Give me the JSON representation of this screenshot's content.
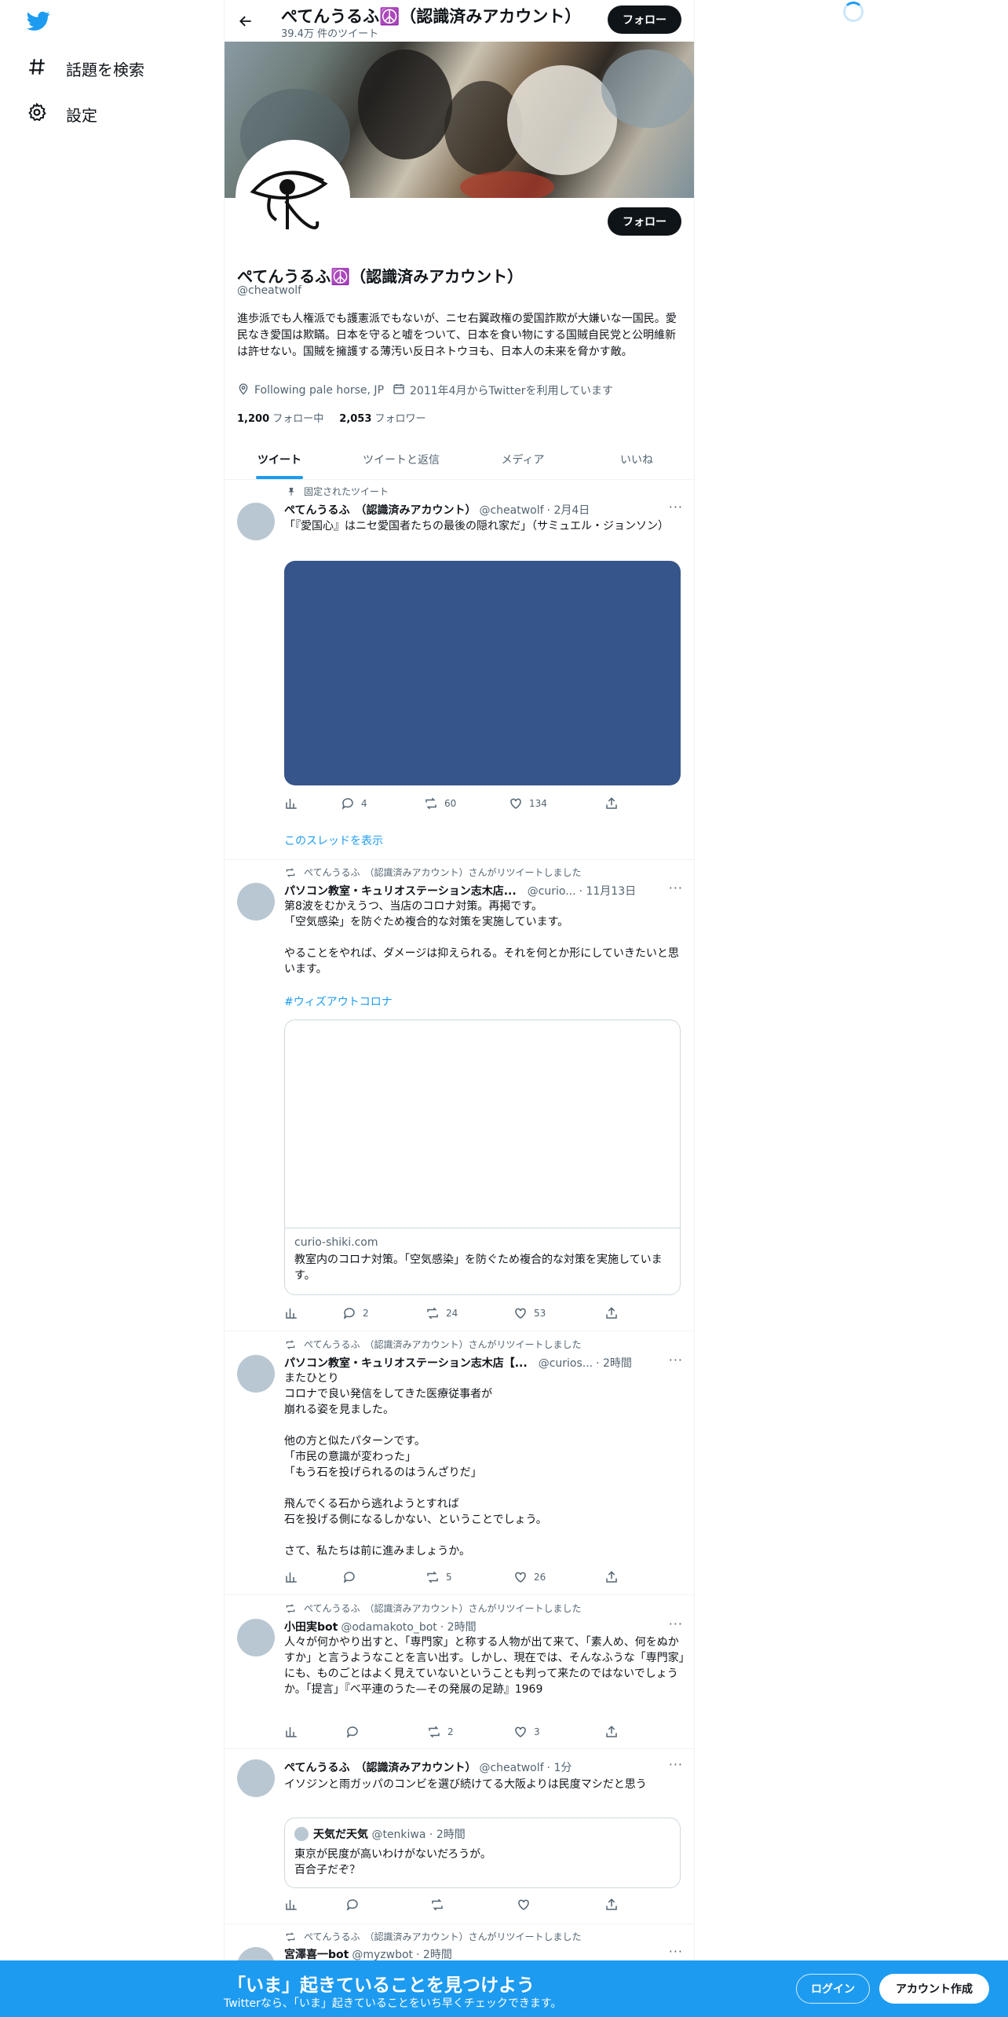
{
  "app": {
    "logo": "twitter-bird-icon",
    "accent": "#1d9bf0"
  },
  "nav": {
    "items": [
      {
        "icon": "hashtag-icon",
        "label": "話題を検索"
      },
      {
        "icon": "gear-icon",
        "label": "設定"
      }
    ]
  },
  "header": {
    "title": "ぺてんうるふ☮️（認識済みアカウント）",
    "tweet_count": "39.4万 件のツイート",
    "follow_label": "フォロー"
  },
  "profile": {
    "name": "ぺてんうるふ☮️（認識済みアカウント）",
    "handle": "@cheatwolf",
    "bio": "進歩派でも人権派でも護憲派でもないが、ニセ右翼政権の愛国詐欺が大嫌いな一国民。愛民なき愛国は欺瞞。日本を守ると嘘をついて、日本を食い物にする国賊自民党と公明維新は許せない。国賊を擁護する薄汚い反日ネトウヨも、日本人の未来を脅かす敵。",
    "location": "Following pale horse, JP",
    "joined": "2011年4月からTwitterを利用しています",
    "following_count": "1,200",
    "following_label": "フォロー中",
    "followers_count": "2,053",
    "followers_label": "フォロワー",
    "follow_label": "フォロー"
  },
  "tabs": [
    {
      "label": "ツイート",
      "active": true
    },
    {
      "label": "ツイートと返信",
      "active": false
    },
    {
      "label": "メディア",
      "active": false
    },
    {
      "label": "いいね",
      "active": false
    }
  ],
  "tweets": [
    {
      "context": "固定されたツイート",
      "name": "ぺてんうるふ　（認識済みアカウント）",
      "handle": "@cheatwolf",
      "time": "· 2月4日",
      "text": "「『愛国心』はニセ愛国者たちの最後の隠れ家だ」（サミュエル・ジョンソン）",
      "media_color": "#36558a",
      "replies": "4",
      "retweets": "60",
      "likes": "134",
      "thread_link": "このスレッドを表示"
    },
    {
      "context": "ぺてんうるふ　（認識済みアカウント）さんがリツイートしました",
      "name": "パソコン教室・キュリオステーション志木店...",
      "handle": "@curio...",
      "time": "· 11月13日",
      "text": "第8波をむかえうつ、当店のコロナ対策。再掲です。\n「空気感染」を防ぐため複合的な対策を実施しています。\n\nやることをやれば、ダメージは抑えられる。それを何とか形にしていきたいと思います。",
      "hashtag": "#ウィズアウトコロナ",
      "card_domain": "curio-shiki.com",
      "card_title": "教室内のコロナ対策。「空気感染」を防ぐため複合的な対策を実施しています。",
      "replies": "2",
      "retweets": "24",
      "likes": "53"
    },
    {
      "context": "ぺてんうるふ　（認識済みアカウント）さんがリツイートしました",
      "name": "パソコン教室・キュリオステーション志木店【...",
      "handle": "@curios...",
      "time": "· 2時間",
      "text": "またひとり\nコロナで良い発信をしてきた医療従事者が\n崩れる姿を見ました。\n\n他の方と似たパターンです。\n「市民の意識が変わった」\n「もう石を投げられるのはうんざりだ」\n\n飛んでくる石から逃れようとすれば\n石を投げる側になるしかない、ということでしょう。\n\nさて、私たちは前に進みましょうか。",
      "replies": "",
      "retweets": "5",
      "likes": "26"
    },
    {
      "context": "ぺてんうるふ　（認識済みアカウント）さんがリツイートしました",
      "name": "小田実bot",
      "handle": "@odamakoto_bot",
      "time": "· 2時間",
      "text": "人々が何かやり出すと、「専門家」と称する人物が出て来て、「素人め、何をぬかすか」と言うようなことを言い出す。しかし、現在では、そんなふうな「専門家」にも、ものごとはよく見えていないということも判って来たのではないでしょうか。「提言」『べ平連のうた—その発展の足跡』1969",
      "replies": "",
      "retweets": "2",
      "likes": "3"
    },
    {
      "name": "ぺてんうるふ　（認識済みアカウント）",
      "handle": "@cheatwolf",
      "time": "· 1分",
      "text": "イソジンと雨ガッパのコンビを選び続けてる大阪よりは民度マシだと思う",
      "quote_name": "天気だ天気",
      "quote_handle": "@tenkiwa",
      "quote_time": "· 2時間",
      "quote_text": "東京が民度が高いわけがないだろうが。\n百合子だぞ？",
      "replies": "",
      "retweets": "",
      "likes": ""
    },
    {
      "context": "ぺてんうるふ　（認識済みアカウント）さんがリツイートしました",
      "name": "宮澤喜一bot",
      "handle": "@myzwbot",
      "time": "· 2時間"
    }
  ],
  "bottom_bar": {
    "title": "「いま」起きていることを見つけよう",
    "subtitle": "Twitterなら、「いま」起きていることをいち早くチェックできます。",
    "login": "ログイン",
    "signup": "アカウント作成"
  }
}
